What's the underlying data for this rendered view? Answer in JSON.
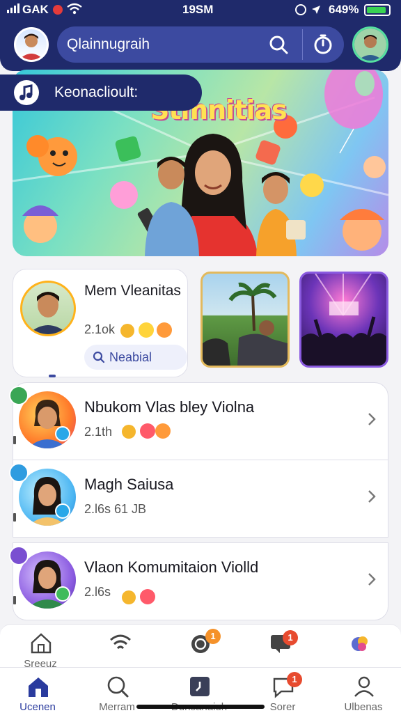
{
  "status_bar": {
    "carrier": "GAK",
    "time": "19SM",
    "battery_pct": "649%",
    "battery_level": 0.9
  },
  "header": {
    "search_text": "Qlainnugraih",
    "icons": [
      "avatar",
      "search-icon",
      "timer-icon",
      "profile-avatar"
    ]
  },
  "music_chip": {
    "label": "Keonaclioult:"
  },
  "banner": {
    "title": "Stmnitias"
  },
  "featured": {
    "name": "Mem Vleanitas",
    "count": "2.1ok",
    "nearby_label": "Neabial"
  },
  "chats": [
    {
      "title": "Nbukom Vlas bley Violna",
      "sub": "2.1th",
      "tag_color": "#3aa655",
      "status_color": "#29a7e8"
    },
    {
      "title": "Magh Saiusa",
      "sub": "2.l6s 61 JB",
      "tag_color": "#2f9ce0",
      "status_color": "#29a7e8"
    },
    {
      "title": "Vlaon Komumitaion Violld",
      "sub": "2.l6s",
      "tag_color": "#7a4fd1",
      "status_color": "#3fbb5b"
    }
  ],
  "tabbar_top": {
    "badges": [
      "1",
      "1"
    ],
    "label_first": "Sreeuz"
  },
  "tabbar_bottom": {
    "tabs": [
      {
        "label": "Ucenen",
        "active": true
      },
      {
        "label": "Merram",
        "active": false
      },
      {
        "label": "Dunsanaiuh",
        "active": false
      },
      {
        "label": "Sorer",
        "active": false
      },
      {
        "label": "Ulbenas",
        "active": false
      }
    ],
    "badge": "1"
  },
  "colors": {
    "header_bg": "#1f2a6b",
    "accent": "#3c4aa0",
    "badge": "#e74b2f"
  }
}
